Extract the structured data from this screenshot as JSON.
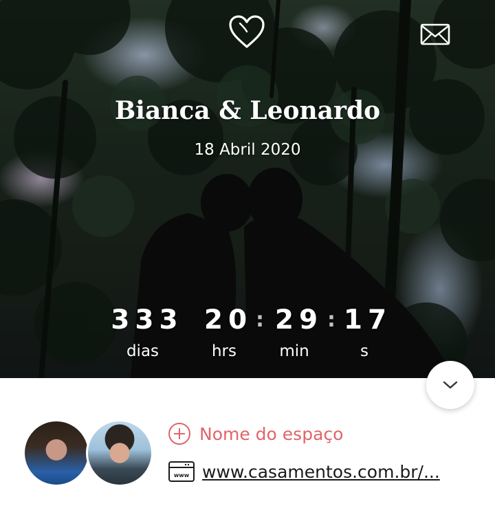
{
  "header": {
    "heart_icon": "heart-outline-icon",
    "envelope_icon": "envelope-icon",
    "couple_names": "Bianca & Leonardo",
    "wedding_date": "18 Abril 2020"
  },
  "countdown": {
    "days": "333",
    "hours": "20",
    "minutes": "29",
    "seconds": "17",
    "separator": ":",
    "days_label": "dias",
    "hours_label": "hrs",
    "minutes_label": "min",
    "seconds_label": "s"
  },
  "expand_button": {
    "icon": "chevron-down-icon"
  },
  "info": {
    "venue_label": "Nome do espaço",
    "venue_icon": "plus-circle-icon",
    "website_icon": "www-icon",
    "website_text": "www.casamentos.com.br/..."
  },
  "colors": {
    "accent": "#e06468",
    "text_dark": "#1a1a1a",
    "white": "#ffffff"
  }
}
